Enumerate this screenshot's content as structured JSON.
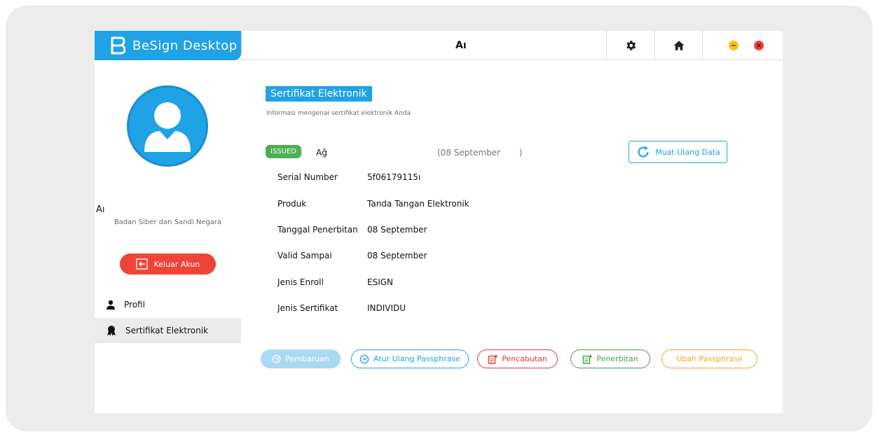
{
  "app": {
    "name": "BeSign Desktop",
    "title_center": "Aı",
    "brand_color": "#1fa2e6"
  },
  "titlebar": {
    "settings_icon": "gear-icon",
    "home_icon": "home-icon",
    "minimize_icon": "minimize-icon",
    "close_icon": "close-icon"
  },
  "sidebar": {
    "user_name": "Aı",
    "organization": "Badan Siber dan Sandi Negara",
    "logout_label": "Keluar Akun",
    "items": [
      {
        "label": "Profil",
        "icon": "user-icon",
        "active": false
      },
      {
        "label": "Sertifikat Elektronik",
        "icon": "certificate-icon",
        "active": true
      }
    ]
  },
  "main": {
    "title": "Sertifikat Elektronik",
    "subtitle": "Informasi mengenai sertifikat elektronik Anda",
    "status_badge": "ISSUED",
    "cert_name": "Ağ",
    "cert_date": "(08 September       )",
    "reload_label": "Muat Ulang Data",
    "details": [
      {
        "key": "Serial Number",
        "value": "5f06179115ı"
      },
      {
        "key": "Produk",
        "value": "Tanda Tangan Elektronik"
      },
      {
        "key": "Tanggal Penerbitan",
        "value": "08 September"
      },
      {
        "key": "Valid Sampai",
        "value": "08 September"
      },
      {
        "key": "Jenis Enroll",
        "value": "ESIGN"
      },
      {
        "key": "Jenis Sertifikat",
        "value": "INDIVIDU"
      }
    ],
    "actions": {
      "pembaruan": {
        "label": "Pembaruan",
        "enabled": false,
        "color": "#a9daf2"
      },
      "atur_ulang": {
        "label": "Atur Ulang Passphrase",
        "color": "#1fa2e6"
      },
      "pencabutan": {
        "label": "Pencabutan",
        "color": "#e53935"
      },
      "penerbitan": {
        "label": "Penerbitan",
        "color": "#43a047"
      },
      "ubah": {
        "label": "Ubah Passphrase",
        "color": "#f5a623"
      }
    }
  }
}
